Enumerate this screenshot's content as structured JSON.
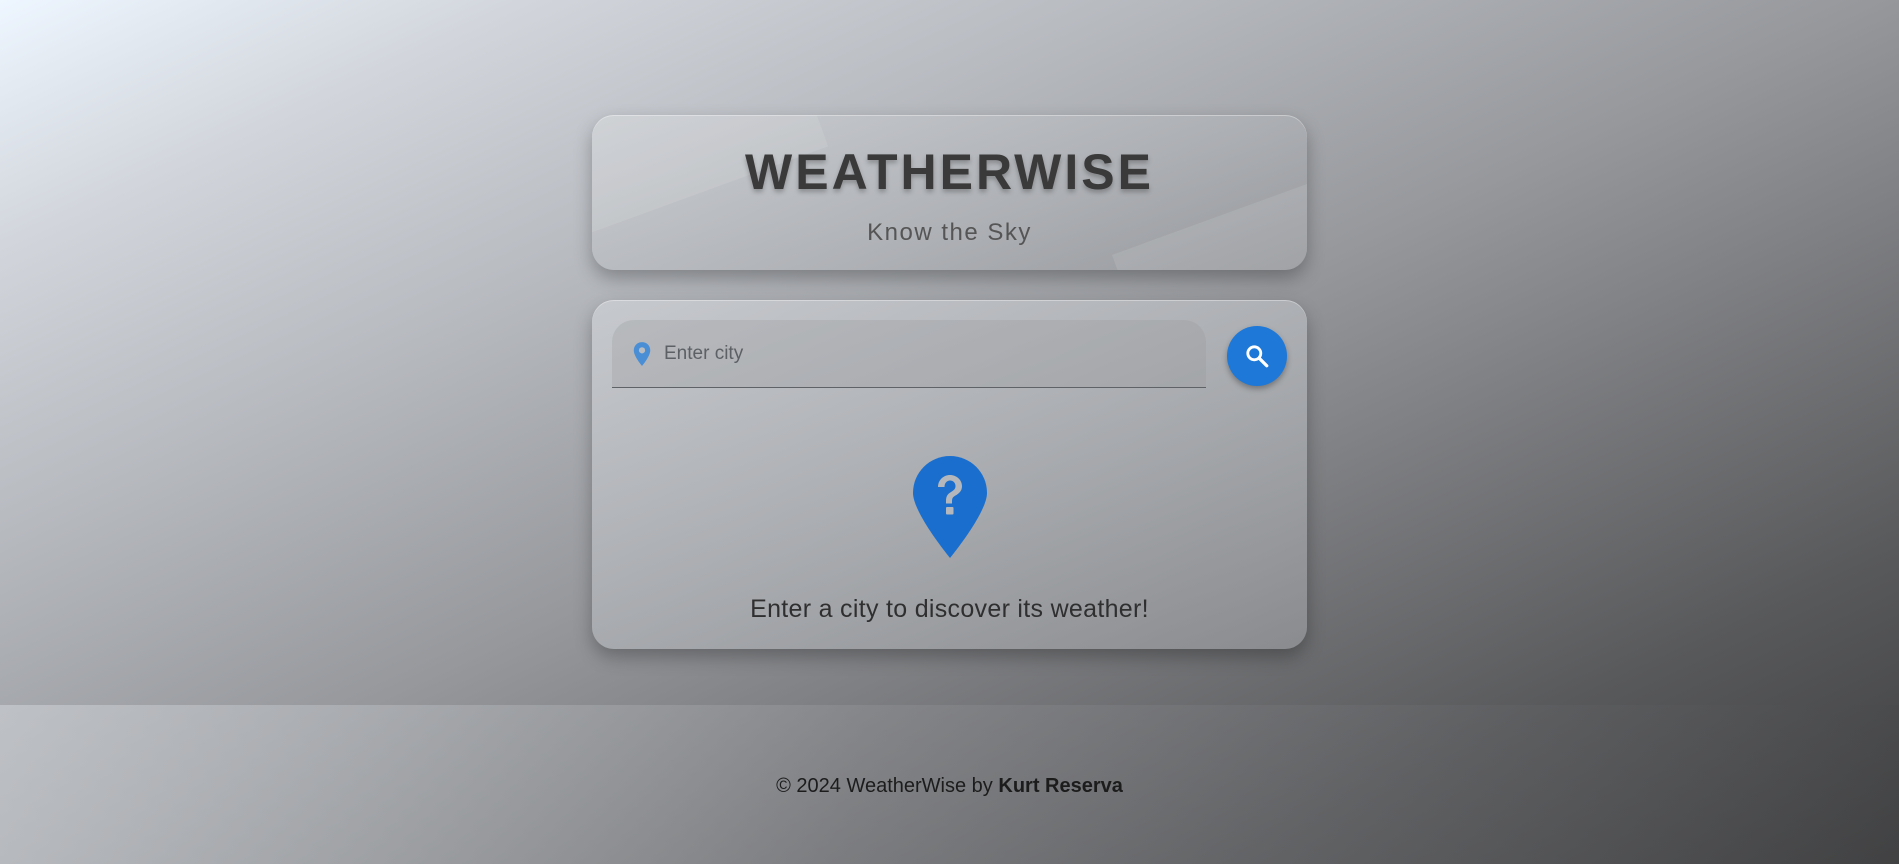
{
  "header": {
    "title": "WEATHERWISE",
    "subtitle": "Know the Sky"
  },
  "search": {
    "placeholder": "Enter city",
    "value": "",
    "location_icon": "map-pin-icon",
    "button_icon": "search-icon"
  },
  "empty_state": {
    "icon": "question-pin-icon",
    "message": "Enter a city to discover its weather!"
  },
  "footer": {
    "copyright": "© 2024 WeatherWise by",
    "author": "Kurt Reserva"
  },
  "colors": {
    "accent": "#1e78d8",
    "title": "#3a3a3a"
  }
}
